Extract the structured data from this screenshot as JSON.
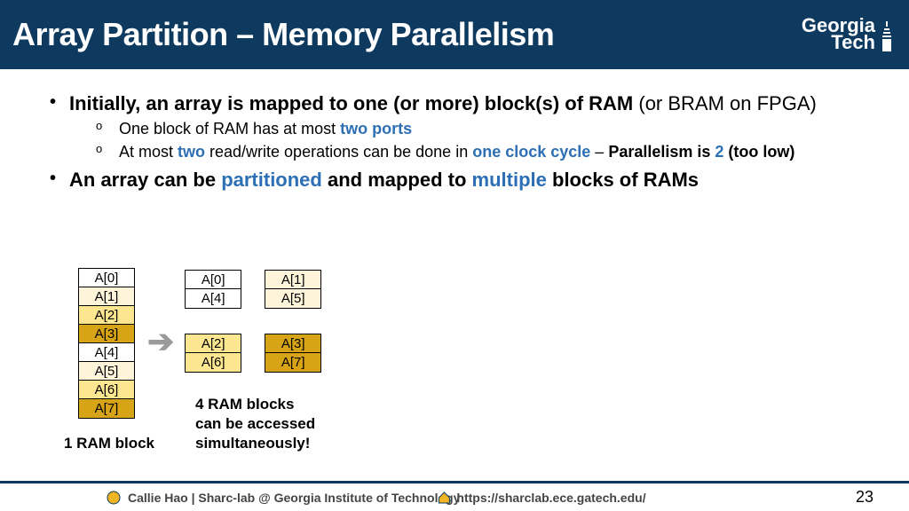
{
  "header": {
    "title": "Array Partition – Memory Parallelism",
    "logo_l1": "Georgia",
    "logo_l2": "Tech"
  },
  "bullets": {
    "b1_strong": "Initially, an array is mapped to one (or more) block(s) of RAM",
    "b1_rest": " (or BRAM on FPGA)",
    "s1a_pre": "One block of RAM has at most ",
    "s1a_hl": "two ports",
    "s1b_pre": "At most ",
    "s1b_hl1": "two",
    "s1b_mid": " read/write operations can be done in ",
    "s1b_hl2": "one clock cycle",
    "s1b_dash": " – ",
    "s1b_strong": "Parallelism is ",
    "s1b_hl3": "2",
    "s1b_tail": " (too low)",
    "b2_pre": "An array can be ",
    "b2_hl1": "partitioned",
    "b2_mid": " and mapped to ",
    "b2_hl2": "multiple",
    "b2_post": " blocks of RAMs"
  },
  "cells": {
    "left": [
      "A[0]",
      "A[1]",
      "A[2]",
      "A[3]",
      "A[4]",
      "A[5]",
      "A[6]",
      "A[7]"
    ],
    "g00": [
      "A[0]",
      "A[4]"
    ],
    "g01": [
      "A[1]",
      "A[5]"
    ],
    "g10": [
      "A[2]",
      "A[6]"
    ],
    "g11": [
      "A[3]",
      "A[7]"
    ]
  },
  "labels": {
    "left": "1 RAM block",
    "right_l1": "4 RAM blocks",
    "right_l2": "can be accessed",
    "right_l3": "simultaneously!"
  },
  "footer": {
    "author": "Callie Hao | Sharc-lab @ Georgia Institute of Technology",
    "url": "https://sharclab.ece.gatech.edu/",
    "page": "23"
  },
  "arrow": "➔"
}
